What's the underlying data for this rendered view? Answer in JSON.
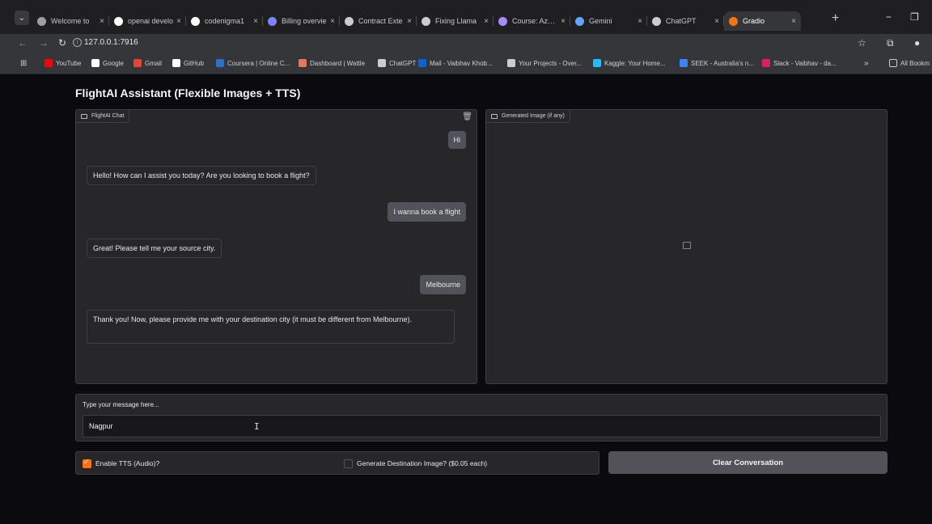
{
  "browser": {
    "tabs": [
      {
        "label": "Welcome to",
        "icon": "chrome-icon",
        "color": "#9aa0a6"
      },
      {
        "label": "openai develo",
        "icon": "google-icon",
        "color": "#ffffff"
      },
      {
        "label": "codenigma1",
        "icon": "github-icon",
        "color": "#ffffff"
      },
      {
        "label": "Billing overvie",
        "icon": "billing-icon",
        "color": "#7c83fd"
      },
      {
        "label": "Contract Exte",
        "icon": "openai-icon",
        "color": "#cccccc"
      },
      {
        "label": "Fixing Llama",
        "icon": "openai-icon",
        "color": "#cccccc"
      },
      {
        "label": "Course: Azure",
        "icon": "course-icon",
        "color": "#a78bfa"
      },
      {
        "label": "Gemini",
        "icon": "gemini-icon",
        "color": "#60a5fa"
      },
      {
        "label": "ChatGPT",
        "icon": "openai-icon",
        "color": "#cccccc"
      },
      {
        "label": "Gradio",
        "icon": "gradio-icon",
        "color": "#f97316"
      }
    ],
    "url": "127.0.0.1:7916",
    "bookmarks": [
      {
        "label": "YouTube",
        "color": "#ff0000"
      },
      {
        "label": "Google",
        "color": "#ffffff"
      },
      {
        "label": "Gmail",
        "color": "#ea4335"
      },
      {
        "label": "GitHub",
        "color": "#ffffff"
      },
      {
        "label": "Coursera | Online C...",
        "color": "#2a73cc"
      },
      {
        "label": "Dashboard | Wattle",
        "color": "#e8765c"
      },
      {
        "label": "ChatGPT",
        "color": "#cccccc"
      },
      {
        "label": "Mail - Vaibhav Khob...",
        "color": "#0a64d6"
      },
      {
        "label": "Your Projects - Over...",
        "color": "#cccccc"
      },
      {
        "label": "Kaggle: Your Home...",
        "color": "#20beff"
      },
      {
        "label": "SEEK - Australia's n...",
        "color": "#3b82f6"
      },
      {
        "label": "Slack - Vaibhav - da...",
        "color": "#e01e5a"
      }
    ],
    "all_bookmarks": "All Bookm"
  },
  "app": {
    "title": "FlightAI Assistant (Flexible Images + TTS)",
    "chat_label": "FlightAI Chat",
    "image_label": "Generated Image (if any)",
    "messages": [
      {
        "role": "user",
        "text": "Hi"
      },
      {
        "role": "bot",
        "text": "Hello! How can I assist you today? Are you looking to book a flight?"
      },
      {
        "role": "user",
        "text": "I wanna book a flight"
      },
      {
        "role": "bot",
        "text": "Great! Please tell me your source city."
      },
      {
        "role": "user",
        "text": "Melbourne"
      },
      {
        "role": "bot",
        "text": "Thank you! Now, please provide me with your destination city (it must be different from Melbourne)."
      }
    ],
    "input_label": "Type your message here...",
    "input_value": "Nagpur",
    "tts_label": "Enable TTS (Audio)?",
    "tts_checked": true,
    "image_gen_label": "Generate Destination Image? ($0.05 each)",
    "image_gen_checked": false,
    "clear_label": "Clear Conversation",
    "accent": "#f97316"
  }
}
